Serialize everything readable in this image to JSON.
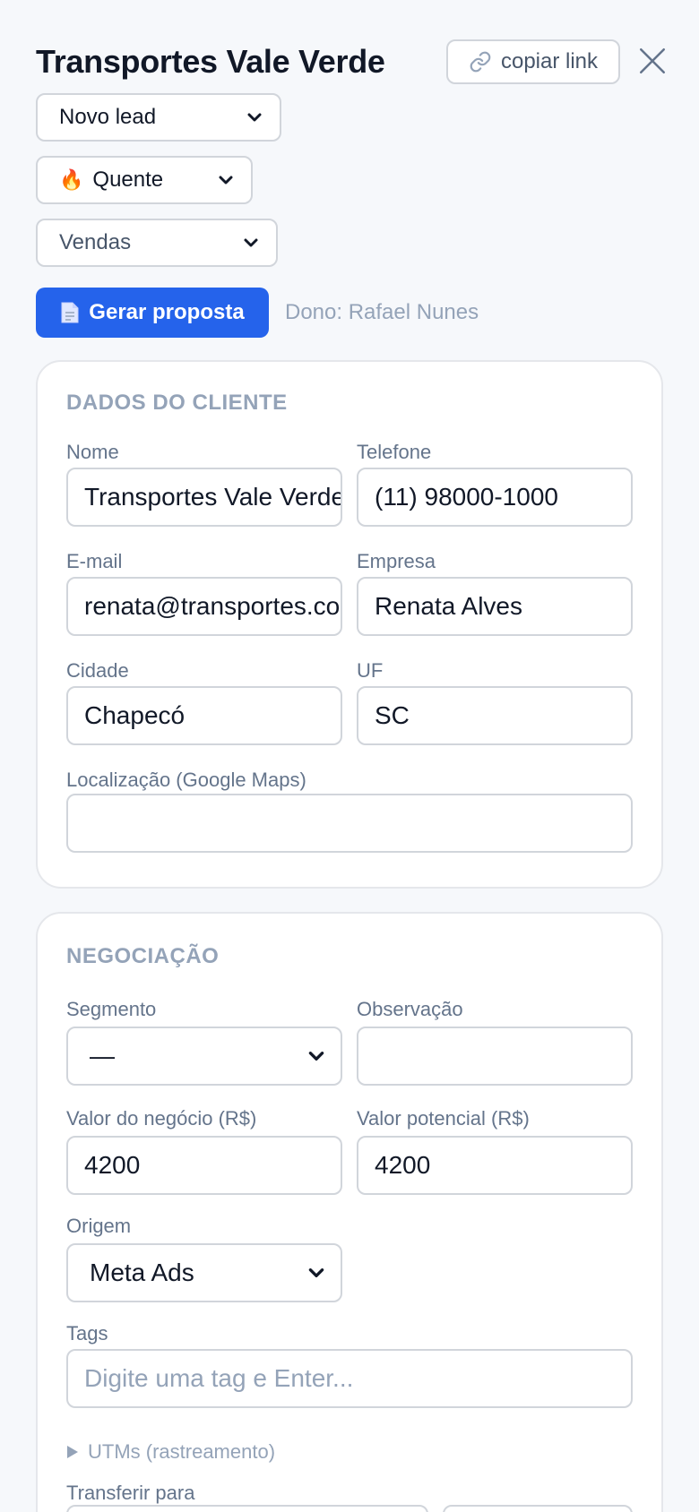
{
  "header": {
    "title": "Transportes Vale Verde",
    "copy_link_label": "copiar link"
  },
  "status_select": {
    "value": "Novo lead"
  },
  "temperature_select": {
    "value": "Quente",
    "icon": "flame-icon"
  },
  "department_select": {
    "value": "Vendas"
  },
  "actions": {
    "generate_proposal_label": "Gerar proposta",
    "owner_text": "Dono: Rafael Nunes"
  },
  "client_section": {
    "title": "DADOS DO CLIENTE",
    "name_label": "Nome",
    "name_value": "Transportes Vale Verde",
    "phone_label": "Telefone",
    "phone_value": "(11) 98000-1000",
    "email_label": "E-mail",
    "email_value": "renata@transportes.com.br",
    "company_label": "Empresa",
    "company_value": "Renata Alves",
    "city_label": "Cidade",
    "city_value": "Chapecó",
    "state_label": "UF",
    "state_value": "SC",
    "location_label": "Localização (Google Maps)",
    "location_value": ""
  },
  "deal_section": {
    "title": "NEGOCIAÇÃO",
    "segment_label": "Segmento",
    "segment_value": "—",
    "note_label": "Observação",
    "note_value": "",
    "deal_value_label": "Valor do negócio (R$)",
    "deal_value": "4200",
    "potential_value_label": "Valor potencial (R$)",
    "potential_value": "4200",
    "origin_label": "Origem",
    "origin_value": "Meta Ads",
    "tags_label": "Tags",
    "tags_placeholder": "Digite uma tag e Enter...",
    "utm_label": "UTMs (rastreamento)",
    "transfer_label": "Transferir para"
  },
  "colors": {
    "primary": "#2563eb",
    "background": "#f6f8fb",
    "border": "#d1d5db",
    "muted_text": "#94a3b8"
  }
}
